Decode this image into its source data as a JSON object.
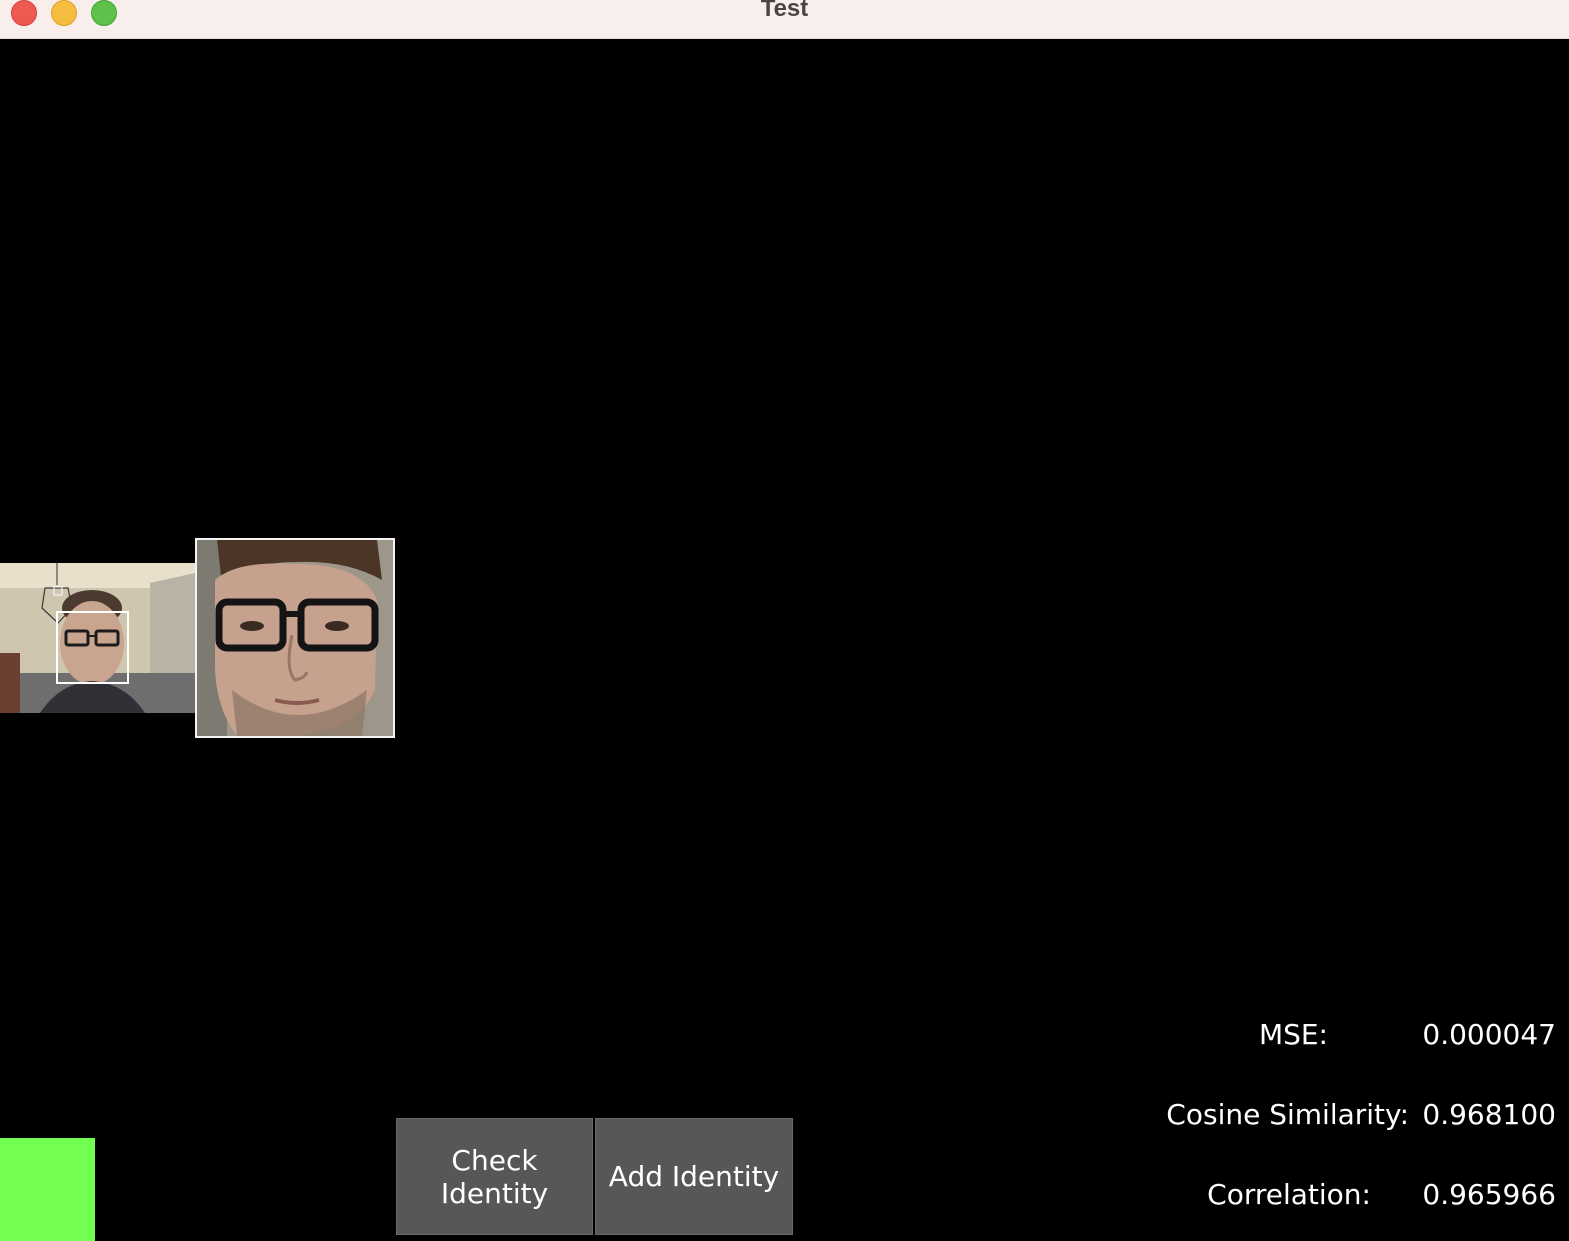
{
  "window": {
    "title": "Test"
  },
  "buttons": {
    "check_identity": "Check Identity",
    "add_identity": "Add Identity"
  },
  "metrics": [
    {
      "label": "MSE:",
      "value": "0.000047"
    },
    {
      "label": "Cosine Similarity:",
      "value": "0.968100"
    },
    {
      "label": "Correlation:",
      "value": "0.965966"
    }
  ],
  "colors": {
    "status_indicator": "#72ff52",
    "background": "#000000",
    "button_bg": "#575757",
    "titlebar_bg": "#f8efec"
  },
  "icons": {
    "close": "close-button-icon",
    "minimize": "minimize-button-icon",
    "zoom": "zoom-button-icon"
  }
}
